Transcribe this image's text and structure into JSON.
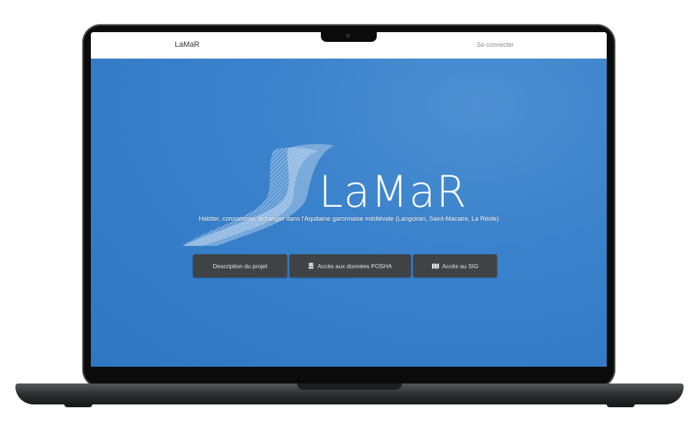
{
  "navbar": {
    "brand": "LaMaR",
    "login_label": "Se connecter"
  },
  "hero": {
    "logo_text": "LaMaR",
    "subtitle": "Habiter, consommer, échanger dans l'Aquitaine garonnaise médiévale (Langoiran, Saint-Macaire, La Réole)",
    "background_color": "#3a82cc"
  },
  "buttons": [
    {
      "label": "Description du projet",
      "icon": ""
    },
    {
      "label": "Accès aux données POSHA",
      "icon": "database-icon"
    },
    {
      "label": "Accès au SIG",
      "icon": "map-icon"
    }
  ],
  "colors": {
    "button_bg": "#3f4346",
    "hero_blue": "#3a82cc"
  }
}
